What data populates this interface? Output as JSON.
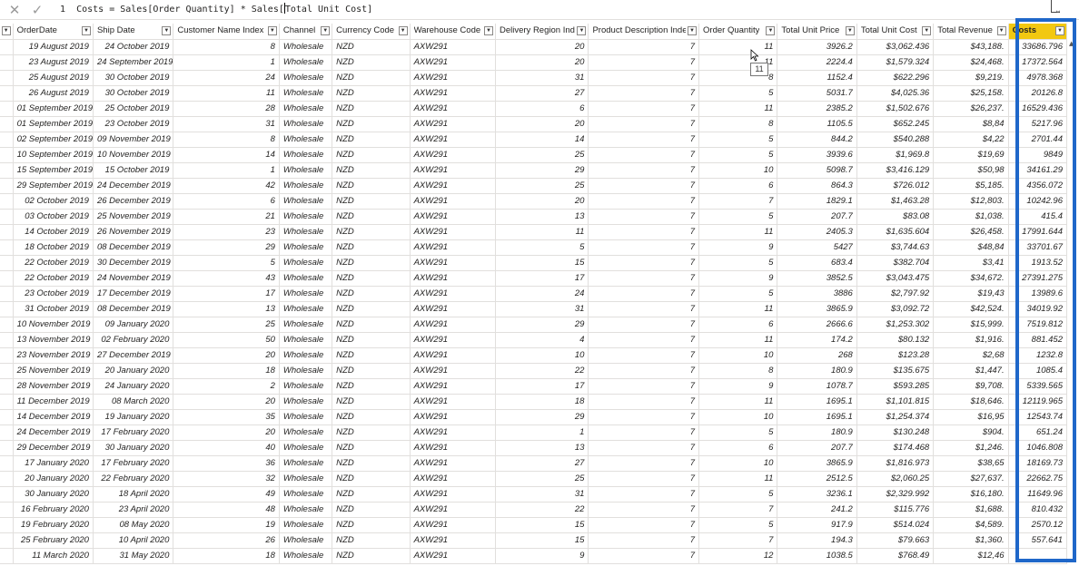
{
  "formula_bar": {
    "cancel_icon": "close-icon",
    "commit_icon": "check-icon",
    "line_number": "1",
    "formula": "Costs = Sales[Order Quantity] * Sales[Total Unit Cost]",
    "formula_before_caret": "Costs = Sales[Order Quantity] * Sales[",
    "formula_after_caret": "Total Unit Cost]"
  },
  "tooltip": "11",
  "colors": {
    "highlight": "#f2c811",
    "selection": "#1f67c9"
  },
  "columns": [
    {
      "label": "OrderDate",
      "align": "r"
    },
    {
      "label": "Ship Date",
      "align": "r"
    },
    {
      "label": "Customer Name Index",
      "align": "r"
    },
    {
      "label": "Channel",
      "align": "l"
    },
    {
      "label": "Currency Code",
      "align": "l"
    },
    {
      "label": "Warehouse Code",
      "align": "l"
    },
    {
      "label": "Delivery Region Index",
      "align": "r"
    },
    {
      "label": "Product Description Index",
      "align": "r"
    },
    {
      "label": "Order Quantity",
      "align": "r"
    },
    {
      "label": "Total Unit Price",
      "align": "r"
    },
    {
      "label": "Total Unit Cost",
      "align": "r"
    },
    {
      "label": "Total Revenue",
      "align": "r"
    },
    {
      "label": "Costs",
      "align": "r",
      "highlight": true
    }
  ],
  "rows": [
    [
      "19 August 2019",
      "24 October 2019",
      "8",
      "Wholesale",
      "NZD",
      "AXW291",
      "20",
      "7",
      "11",
      "3926.2",
      "$3,062.436",
      "$43,188.",
      "33686.796"
    ],
    [
      "23 August 2019",
      "24 September 2019",
      "1",
      "Wholesale",
      "NZD",
      "AXW291",
      "20",
      "7",
      "11",
      "2224.4",
      "$1,579.324",
      "$24,468.",
      "17372.564"
    ],
    [
      "25 August 2019",
      "30 October 2019",
      "24",
      "Wholesale",
      "NZD",
      "AXW291",
      "31",
      "7",
      "8",
      "1152.4",
      "$622.296",
      "$9,219.",
      "4978.368"
    ],
    [
      "26 August 2019",
      "30 October 2019",
      "11",
      "Wholesale",
      "NZD",
      "AXW291",
      "27",
      "7",
      "5",
      "5031.7",
      "$4,025.36",
      "$25,158.",
      "20126.8"
    ],
    [
      "01 September 2019",
      "25 October 2019",
      "28",
      "Wholesale",
      "NZD",
      "AXW291",
      "6",
      "7",
      "11",
      "2385.2",
      "$1,502.676",
      "$26,237.",
      "16529.436"
    ],
    [
      "01 September 2019",
      "23 October 2019",
      "31",
      "Wholesale",
      "NZD",
      "AXW291",
      "20",
      "7",
      "8",
      "1105.5",
      "$652.245",
      "$8,84",
      "5217.96"
    ],
    [
      "02 September 2019",
      "09 November 2019",
      "8",
      "Wholesale",
      "NZD",
      "AXW291",
      "14",
      "7",
      "5",
      "844.2",
      "$540.288",
      "$4,22",
      "2701.44"
    ],
    [
      "10 September 2019",
      "10 November 2019",
      "14",
      "Wholesale",
      "NZD",
      "AXW291",
      "25",
      "7",
      "5",
      "3939.6",
      "$1,969.8",
      "$19,69",
      "9849"
    ],
    [
      "15 September 2019",
      "15 October 2019",
      "1",
      "Wholesale",
      "NZD",
      "AXW291",
      "29",
      "7",
      "10",
      "5098.7",
      "$3,416.129",
      "$50,98",
      "34161.29"
    ],
    [
      "29 September 2019",
      "24 December 2019",
      "42",
      "Wholesale",
      "NZD",
      "AXW291",
      "25",
      "7",
      "6",
      "864.3",
      "$726.012",
      "$5,185.",
      "4356.072"
    ],
    [
      "02 October 2019",
      "26 December 2019",
      "6",
      "Wholesale",
      "NZD",
      "AXW291",
      "20",
      "7",
      "7",
      "1829.1",
      "$1,463.28",
      "$12,803.",
      "10242.96"
    ],
    [
      "03 October 2019",
      "25 November 2019",
      "21",
      "Wholesale",
      "NZD",
      "AXW291",
      "13",
      "7",
      "5",
      "207.7",
      "$83.08",
      "$1,038.",
      "415.4"
    ],
    [
      "14 October 2019",
      "26 November 2019",
      "23",
      "Wholesale",
      "NZD",
      "AXW291",
      "11",
      "7",
      "11",
      "2405.3",
      "$1,635.604",
      "$26,458.",
      "17991.644"
    ],
    [
      "18 October 2019",
      "08 December 2019",
      "29",
      "Wholesale",
      "NZD",
      "AXW291",
      "5",
      "7",
      "9",
      "5427",
      "$3,744.63",
      "$48,84",
      "33701.67"
    ],
    [
      "22 October 2019",
      "30 December 2019",
      "5",
      "Wholesale",
      "NZD",
      "AXW291",
      "15",
      "7",
      "5",
      "683.4",
      "$382.704",
      "$3,41",
      "1913.52"
    ],
    [
      "22 October 2019",
      "24 November 2019",
      "43",
      "Wholesale",
      "NZD",
      "AXW291",
      "17",
      "7",
      "9",
      "3852.5",
      "$3,043.475",
      "$34,672.",
      "27391.275"
    ],
    [
      "23 October 2019",
      "17 December 2019",
      "17",
      "Wholesale",
      "NZD",
      "AXW291",
      "24",
      "7",
      "5",
      "3886",
      "$2,797.92",
      "$19,43",
      "13989.6"
    ],
    [
      "31 October 2019",
      "08 December 2019",
      "13",
      "Wholesale",
      "NZD",
      "AXW291",
      "31",
      "7",
      "11",
      "3865.9",
      "$3,092.72",
      "$42,524.",
      "34019.92"
    ],
    [
      "10 November 2019",
      "09 January 2020",
      "25",
      "Wholesale",
      "NZD",
      "AXW291",
      "29",
      "7",
      "6",
      "2666.6",
      "$1,253.302",
      "$15,999.",
      "7519.812"
    ],
    [
      "13 November 2019",
      "02 February 2020",
      "50",
      "Wholesale",
      "NZD",
      "AXW291",
      "4",
      "7",
      "11",
      "174.2",
      "$80.132",
      "$1,916.",
      "881.452"
    ],
    [
      "23 November 2019",
      "27 December 2019",
      "20",
      "Wholesale",
      "NZD",
      "AXW291",
      "10",
      "7",
      "10",
      "268",
      "$123.28",
      "$2,68",
      "1232.8"
    ],
    [
      "25 November 2019",
      "20 January 2020",
      "18",
      "Wholesale",
      "NZD",
      "AXW291",
      "22",
      "7",
      "8",
      "180.9",
      "$135.675",
      "$1,447.",
      "1085.4"
    ],
    [
      "28 November 2019",
      "24 January 2020",
      "2",
      "Wholesale",
      "NZD",
      "AXW291",
      "17",
      "7",
      "9",
      "1078.7",
      "$593.285",
      "$9,708.",
      "5339.565"
    ],
    [
      "11 December 2019",
      "08 March 2020",
      "20",
      "Wholesale",
      "NZD",
      "AXW291",
      "18",
      "7",
      "11",
      "1695.1",
      "$1,101.815",
      "$18,646.",
      "12119.965"
    ],
    [
      "14 December 2019",
      "19 January 2020",
      "35",
      "Wholesale",
      "NZD",
      "AXW291",
      "29",
      "7",
      "10",
      "1695.1",
      "$1,254.374",
      "$16,95",
      "12543.74"
    ],
    [
      "24 December 2019",
      "17 February 2020",
      "20",
      "Wholesale",
      "NZD",
      "AXW291",
      "1",
      "7",
      "5",
      "180.9",
      "$130.248",
      "$904.",
      "651.24"
    ],
    [
      "29 December 2019",
      "30 January 2020",
      "40",
      "Wholesale",
      "NZD",
      "AXW291",
      "13",
      "7",
      "6",
      "207.7",
      "$174.468",
      "$1,246.",
      "1046.808"
    ],
    [
      "17 January 2020",
      "17 February 2020",
      "36",
      "Wholesale",
      "NZD",
      "AXW291",
      "27",
      "7",
      "10",
      "3865.9",
      "$1,816.973",
      "$38,65",
      "18169.73"
    ],
    [
      "20 January 2020",
      "22 February 2020",
      "32",
      "Wholesale",
      "NZD",
      "AXW291",
      "25",
      "7",
      "11",
      "2512.5",
      "$2,060.25",
      "$27,637.",
      "22662.75"
    ],
    [
      "30 January 2020",
      "18 April 2020",
      "49",
      "Wholesale",
      "NZD",
      "AXW291",
      "31",
      "7",
      "5",
      "3236.1",
      "$2,329.992",
      "$16,180.",
      "11649.96"
    ],
    [
      "16 February 2020",
      "23 April 2020",
      "48",
      "Wholesale",
      "NZD",
      "AXW291",
      "22",
      "7",
      "7",
      "241.2",
      "$115.776",
      "$1,688.",
      "810.432"
    ],
    [
      "19 February 2020",
      "08 May 2020",
      "19",
      "Wholesale",
      "NZD",
      "AXW291",
      "15",
      "7",
      "5",
      "917.9",
      "$514.024",
      "$4,589.",
      "2570.12"
    ],
    [
      "25 February 2020",
      "10 April 2020",
      "26",
      "Wholesale",
      "NZD",
      "AXW291",
      "15",
      "7",
      "7",
      "194.3",
      "$79.663",
      "$1,360.",
      "557.641"
    ],
    [
      "11 March 2020",
      "31 May 2020",
      "18",
      "Wholesale",
      "NZD",
      "AXW291",
      "9",
      "7",
      "12",
      "1038.5",
      "$768.49",
      "$12,46",
      ""
    ]
  ]
}
